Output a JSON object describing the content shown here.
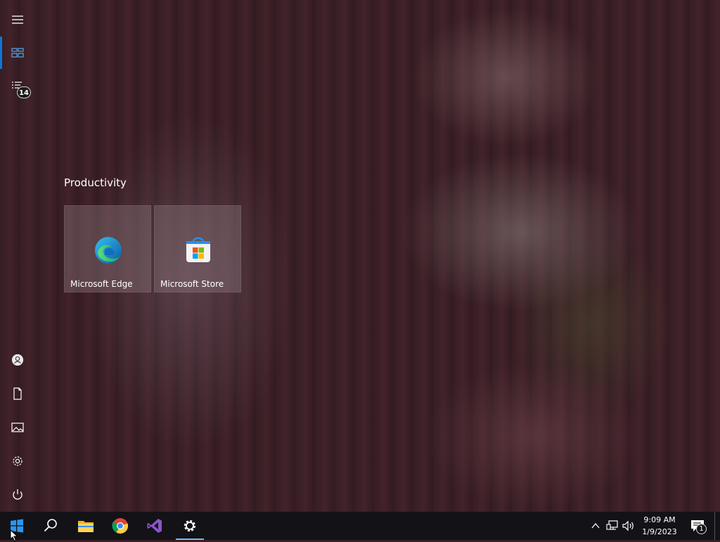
{
  "start_menu": {
    "rail": {
      "menu_icon": "hamburger-icon",
      "pinned_icon": "tiles-icon",
      "all_apps_icon": "list-icon",
      "all_apps_badge": "14",
      "account_icon": "user-icon",
      "documents_icon": "document-icon",
      "pictures_icon": "picture-icon",
      "settings_icon": "gear-icon",
      "power_icon": "power-icon"
    },
    "group": {
      "title": "Productivity",
      "tiles": [
        {
          "label": "Microsoft Edge",
          "icon": "edge-icon"
        },
        {
          "label": "Microsoft Store",
          "icon": "store-icon"
        }
      ]
    }
  },
  "taskbar": {
    "apps": [
      {
        "name": "Start",
        "icon": "windows-icon"
      },
      {
        "name": "Search",
        "icon": "search-icon"
      },
      {
        "name": "File Explorer",
        "icon": "folder-icon"
      },
      {
        "name": "Google Chrome",
        "icon": "chrome-icon"
      },
      {
        "name": "Visual Studio",
        "icon": "visual-studio-icon"
      },
      {
        "name": "Settings",
        "icon": "gear-icon",
        "running": true
      }
    ],
    "tray": {
      "chevron_icon": "chevron-up-icon",
      "network_icon": "network-icon",
      "volume_icon": "volume-icon",
      "time": "9:09 AM",
      "date": "1/9/2023",
      "notifications_icon": "notification-icon",
      "notification_count": "1"
    }
  },
  "colors": {
    "accent": "#0a78d7",
    "taskbar": "#131217",
    "running_indicator": "#76b9ed"
  }
}
